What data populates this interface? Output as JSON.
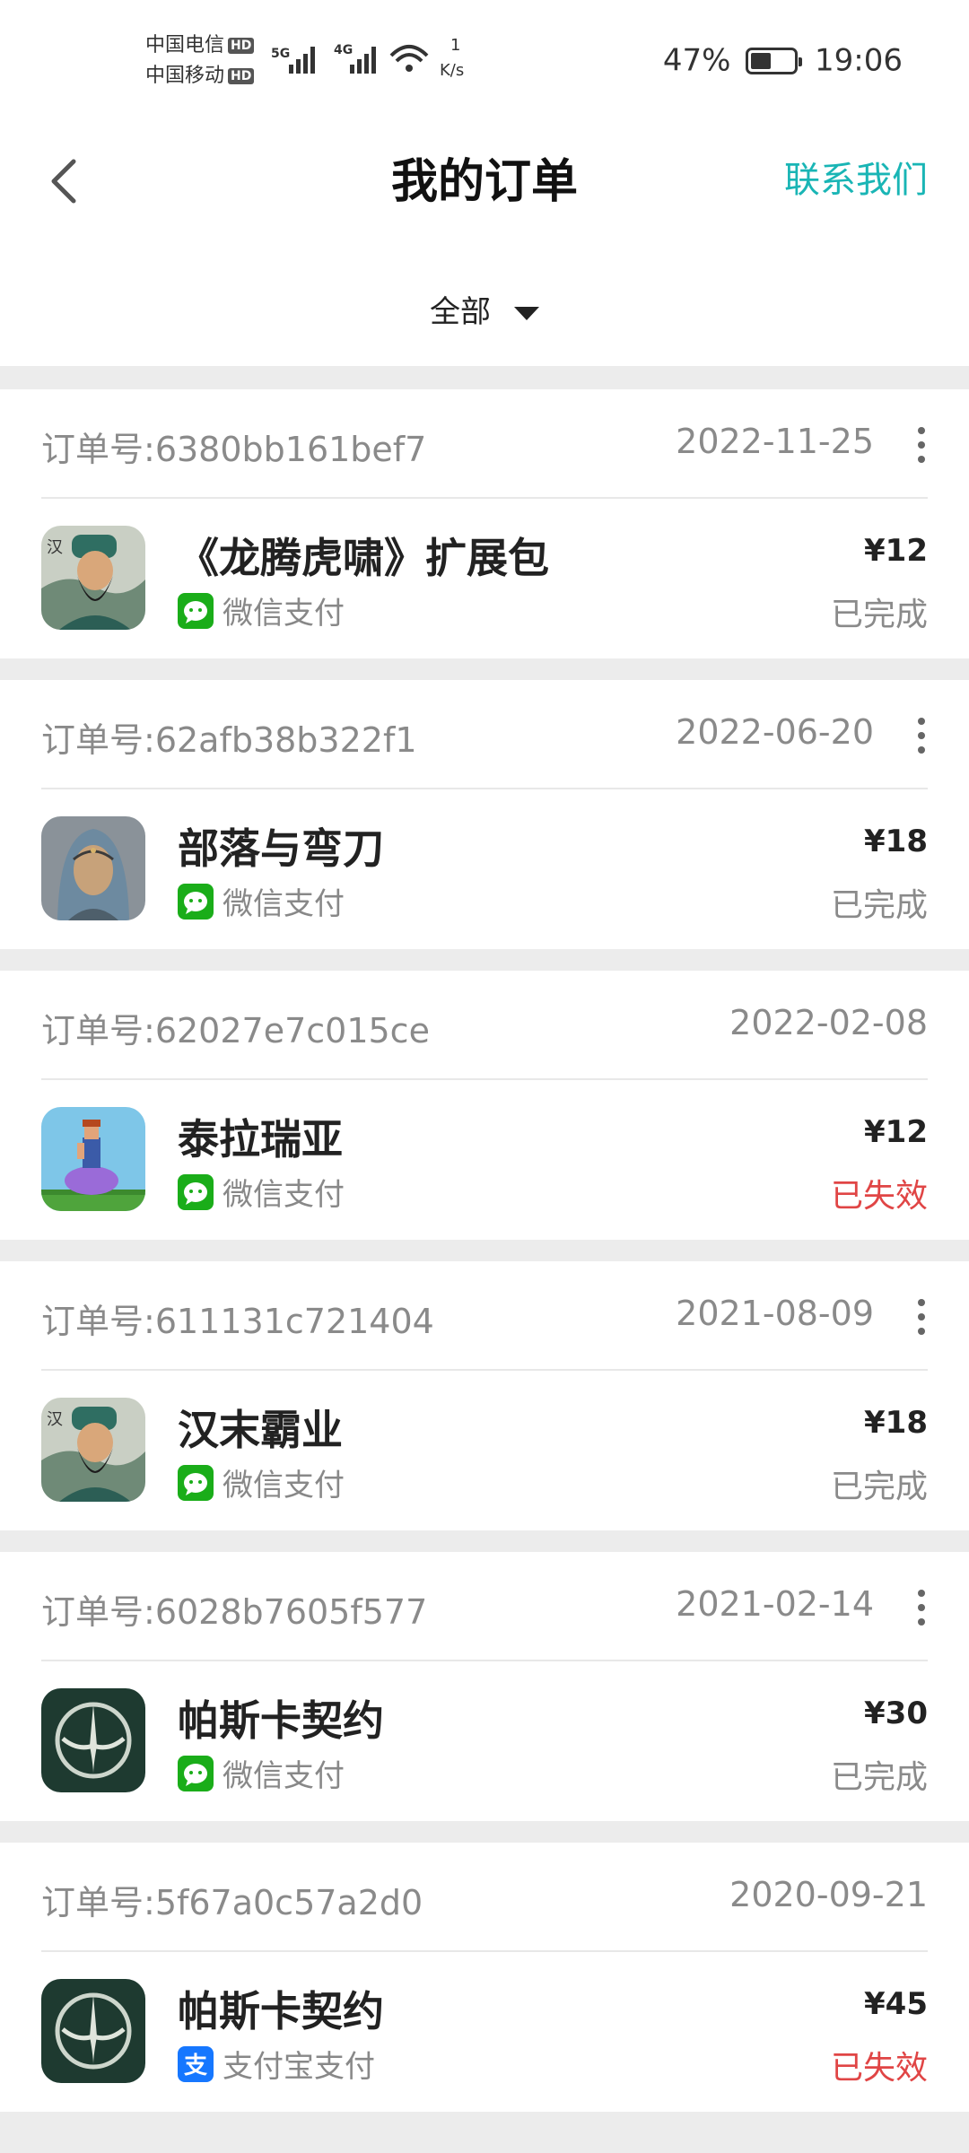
{
  "status_bar": {
    "carrier1": "中国电信",
    "carrier2": "中国移动",
    "hd": "HD",
    "net1": "5G",
    "net2": "4G",
    "speed_value": "1",
    "speed_unit": "K/s",
    "battery_percent": "47%",
    "battery_level": 0.47,
    "time": "19:06"
  },
  "header": {
    "title": "我的订单",
    "contact": "联系我们",
    "filter_label": "全部"
  },
  "orders": [
    {
      "order_label": "订单号:",
      "order_no": "6380bb161bef7",
      "date": "2022-11-25",
      "has_more": true,
      "app_name": "《龙腾虎啸》扩展包",
      "icon": "han-warrior-icon",
      "pay_icon": "wechat-pay-icon",
      "pay_method": "微信支付",
      "price": "¥12",
      "status": "已完成",
      "failed": false
    },
    {
      "order_label": "订单号:",
      "order_no": "62afb38b322f1",
      "date": "2022-06-20",
      "has_more": true,
      "app_name": "部落与弯刀",
      "icon": "tribe-portrait-icon",
      "pay_icon": "wechat-pay-icon",
      "pay_method": "微信支付",
      "price": "¥18",
      "status": "已完成",
      "failed": false
    },
    {
      "order_label": "订单号:",
      "order_no": "62027e7c015ce",
      "date": "2022-02-08",
      "has_more": false,
      "app_name": "泰拉瑞亚",
      "icon": "terraria-pixel-icon",
      "pay_icon": "wechat-pay-icon",
      "pay_method": "微信支付",
      "price": "¥12",
      "status": "已失效",
      "failed": true
    },
    {
      "order_label": "订单号:",
      "order_no": "611131c721404",
      "date": "2021-08-09",
      "has_more": true,
      "app_name": "汉末霸业",
      "icon": "han-warrior-icon",
      "pay_icon": "wechat-pay-icon",
      "pay_method": "微信支付",
      "price": "¥18",
      "status": "已完成",
      "failed": false
    },
    {
      "order_label": "订单号:",
      "order_no": "6028b7605f577",
      "date": "2021-02-14",
      "has_more": true,
      "app_name": "帕斯卡契约",
      "icon": "pascal-emblem-icon",
      "pay_icon": "wechat-pay-icon",
      "pay_method": "微信支付",
      "price": "¥30",
      "status": "已完成",
      "failed": false
    },
    {
      "order_label": "订单号:",
      "order_no": "5f67a0c57a2d0",
      "date": "2020-09-21",
      "has_more": false,
      "app_name": "帕斯卡契约",
      "icon": "pascal-emblem-icon",
      "pay_icon": "alipay-icon",
      "pay_method": "支付宝支付",
      "price": "¥45",
      "status": "已失效",
      "failed": true
    }
  ],
  "colors": {
    "accent": "#19b5b5",
    "failed": "#e04545",
    "wechat": "#1aad19",
    "alipay": "#1677ff"
  }
}
